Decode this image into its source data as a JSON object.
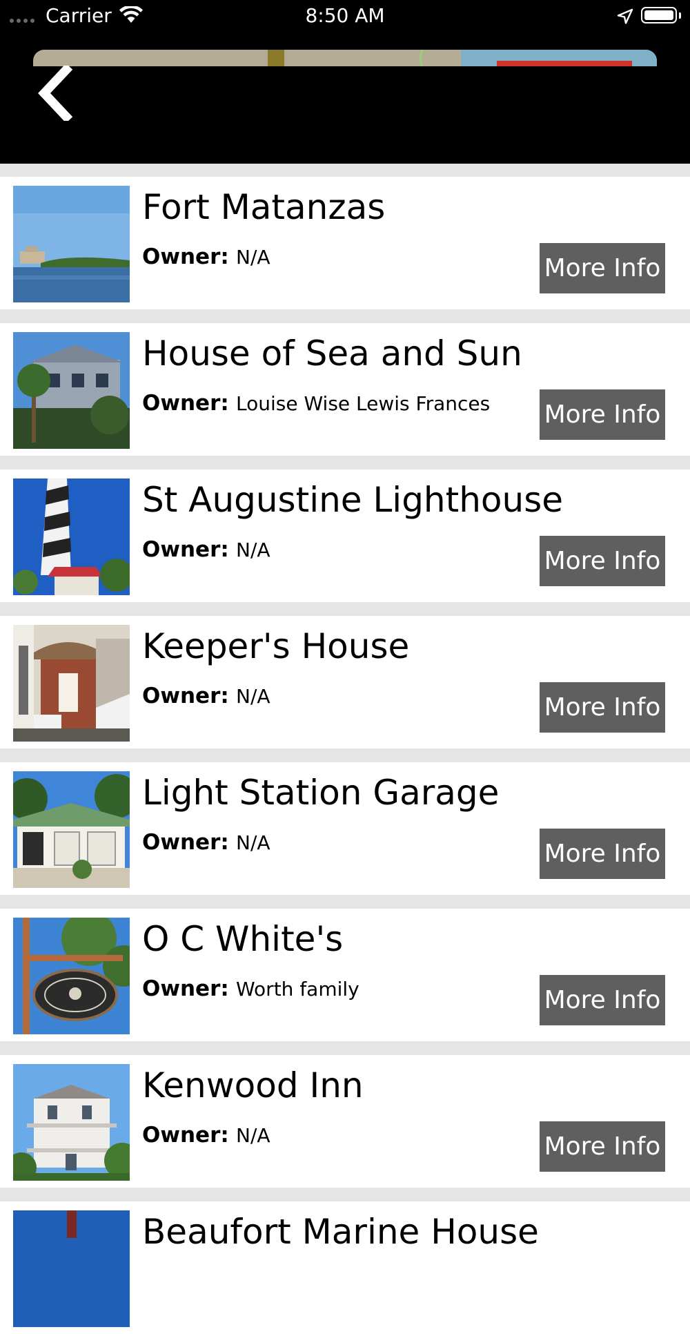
{
  "status_bar": {
    "carrier": "Carrier",
    "time": "8:50 AM"
  },
  "nav": {
    "back_icon": "chevron-left-icon"
  },
  "owner_label": "Owner:",
  "items": [
    {
      "title": "Fort Matanzas",
      "owner": "N/A",
      "button": "More Info"
    },
    {
      "title": "House of Sea and Sun",
      "owner": "Louise Wise Lewis Frances",
      "button": "More Info"
    },
    {
      "title": "St Augustine Lighthouse",
      "owner": "N/A",
      "button": "More Info"
    },
    {
      "title": "Keeper's House",
      "owner": "N/A",
      "button": "More Info"
    },
    {
      "title": "Light Station Garage",
      "owner": "N/A",
      "button": "More Info"
    },
    {
      "title": "O C White's",
      "owner": "Worth family",
      "button": "More Info"
    },
    {
      "title": "Kenwood Inn",
      "owner": "N/A",
      "button": "More Info"
    },
    {
      "title": "Beaufort Marine House",
      "owner": "",
      "button": ""
    }
  ],
  "colors": {
    "separator": "#e5e5e5",
    "button_bg": "#5f5f5f",
    "nav_bg": "#000000"
  }
}
